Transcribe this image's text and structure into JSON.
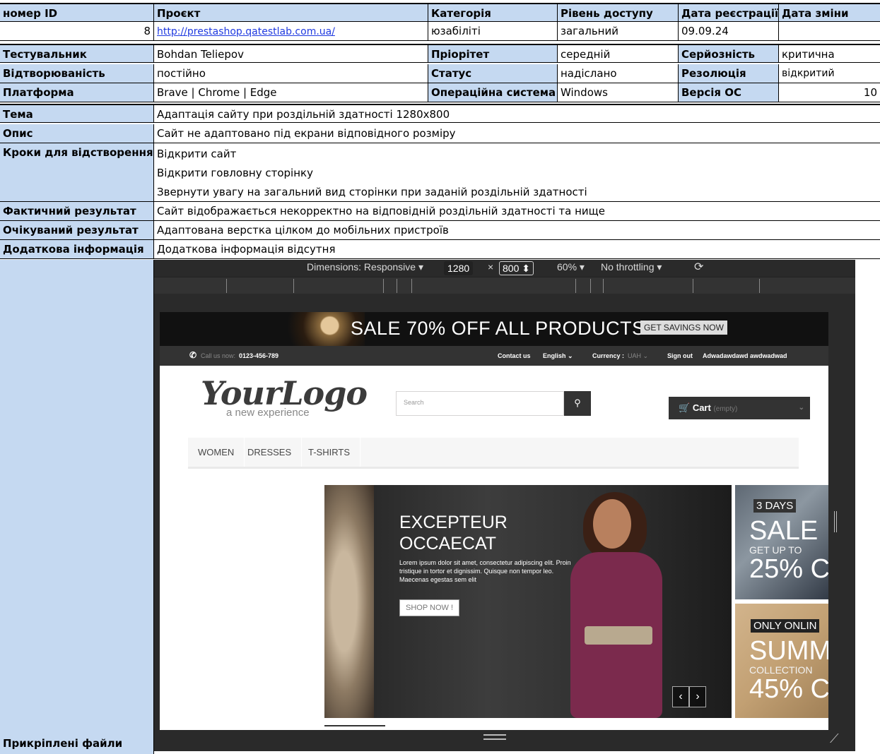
{
  "sheet": {
    "h_id": "номер ID",
    "h_project": "Проєкт",
    "h_category": "Категорія",
    "h_access": "Рівень доступу",
    "h_reg_date": "Дата реєстрації",
    "h_change_date": "Дата зміни",
    "id": "8",
    "project": "http://prestashop.qatestlab.com.ua/",
    "category": "юзабіліті",
    "access": "загальний",
    "reg_date": "09.09.24",
    "change_date": "",
    "l_tester": "Тестувальник",
    "tester": "Bohdan Teliepov",
    "l_priority": "Пріорітет",
    "priority": "середній",
    "l_severity": "Серйозність",
    "severity": "критична",
    "l_repro": "Відтворюваність",
    "repro": "постійно",
    "l_status": "Статус",
    "status": "надіслано",
    "l_resolution": "Резолюція",
    "resolution": "відкритий",
    "l_platform": "Платформа",
    "platform": "Brave | Chrome | Edge",
    "l_os": "Операційна система",
    "os": "Windows",
    "l_os_version": "Версія ОС",
    "os_version": "10",
    "l_topic": "Тема",
    "topic": "Адаптація сайту при роздільній здатності 1280х800",
    "l_desc": "Опис",
    "desc": "Сайт не адаптовано під екрани відповідного розміру",
    "l_steps": "Кроки для відстворення",
    "steps": [
      "Відкрити сайт",
      "Відкрити говловну сторінку",
      "Звернути увагу на загальний вид сторінки при заданій роздільній здатності"
    ],
    "l_actual": "Фактичний результат",
    "actual": "Сайт відображається некорректно на відповідній роздільній здатності та нище",
    "l_expected": "Очікуваний результат",
    "expected": "Адаптована верстка цілком до мобільних пристроїв",
    "l_extra": "Додаткова інформація",
    "extra": "Додаткова інформація відсутня",
    "l_files": "Прикріплені файли"
  },
  "devtools": {
    "dimensions": "Dimensions: Responsive ▾",
    "width": "1280",
    "times": "×",
    "height": "800 ⬍",
    "zoom": "60% ▾",
    "throttle": "No throttling ▾",
    "rotate_icon": "⟳"
  },
  "site": {
    "banner_text": "SALE 70% OFF ALL PRODUCTS",
    "banner_btn": "GET SAVINGS NOW",
    "call_label": "Call us now:",
    "phone": "0123-456-789",
    "contact": "Contact us",
    "language": "English ⌄",
    "currency_label": "Currency :",
    "currency_value": "UAH ⌄",
    "signout": "Sign out",
    "username": "Adwadawdawd awdwadwad",
    "logo": "YourLogo",
    "logo_sub": "a new experience",
    "search_placeholder": "Search",
    "cart": "Cart",
    "cart_empty": "(empty)",
    "menu": [
      "WOMEN",
      "DRESSES",
      "T-SHIRTS"
    ],
    "slide_title_1": "EXCEPTEUR",
    "slide_title_2": "OCCAECAT",
    "slide_copy": "Lorem ipsum dolor sit amet, consectetur adipiscing elit. Proin tristique in tortor et dignissim. Quisque non tempor leo. Maecenas egestas sem elit",
    "slide_btn": "SHOP NOW !",
    "promo1_tag": "3 DAYS",
    "promo1_big": "SALE",
    "promo1_small": "GET UP TO",
    "promo1_pct": "25% C",
    "promo2_tag": "ONLY ONLIN",
    "promo2_big": "SUMM",
    "promo2_small": "COLLECTION",
    "promo2_pct": "45% C"
  }
}
